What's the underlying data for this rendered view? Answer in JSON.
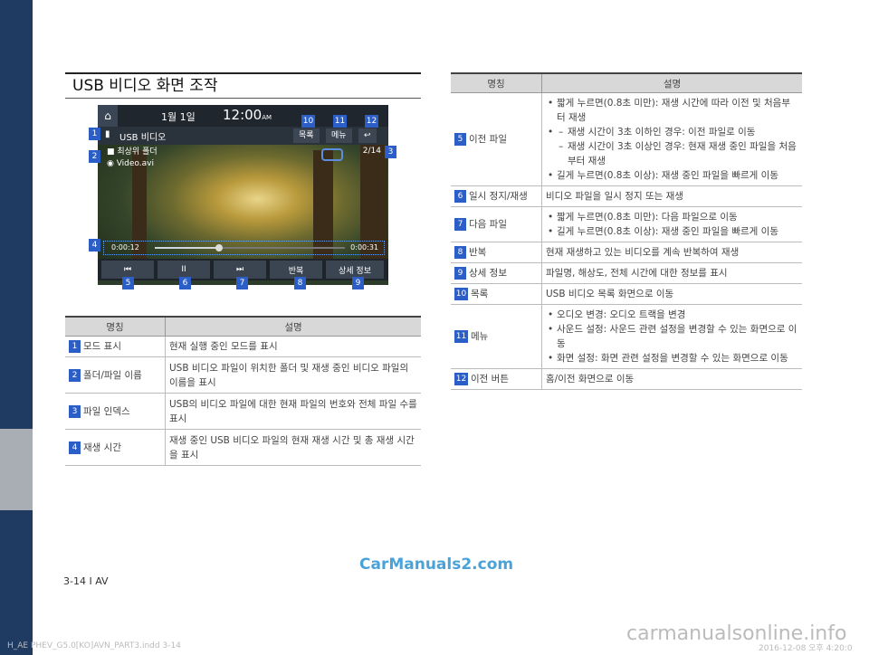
{
  "page_title": "USB 비디오 화면 조작",
  "screen": {
    "date": "1월  1일",
    "clock": "12:00",
    "ampm": "AM",
    "source_title": "USB 비디오",
    "btn_list": "목록",
    "btn_menu": "메뉴",
    "back_symbol": "↩",
    "folder": "최상위 폴더",
    "file": "Video.avi",
    "index": "2/14",
    "time_elapsed": "0:00:12",
    "time_total": "0:00:31",
    "progress": 0.34,
    "prev_symbol": "⏮",
    "pause_symbol": "II",
    "next_symbol": "⏭",
    "btn_repeat": "반복",
    "btn_info": "상세 정보"
  },
  "callouts": [
    "1",
    "2",
    "3",
    "4",
    "5",
    "6",
    "7",
    "8",
    "9",
    "10",
    "11",
    "12"
  ],
  "left_table": {
    "headers": [
      "명칭",
      "설명"
    ],
    "rows": [
      {
        "num": "1",
        "name": "모드 표시",
        "desc": "현재 실행 중인 모드를 표시"
      },
      {
        "num": "2",
        "name": "폴더/파일 이름",
        "desc": "USB 비디오 파일이 위치한 폴더 및 재생 중인 비디오 파일의 이름을 표시"
      },
      {
        "num": "3",
        "name": "파일 인덱스",
        "desc": "USB의 비디오 파일에 대한 현재 파일의 번호와 전체 파일 수를 표시"
      },
      {
        "num": "4",
        "name": "재생 시간",
        "desc": "재생 중인 USB 비디오 파일의 현재 재생 시간 및 총 재생 시간을 표시"
      }
    ]
  },
  "right_table": {
    "headers": [
      "명칭",
      "설명"
    ],
    "r5": {
      "num": "5",
      "name": "이전 파일",
      "b1": "짧게 누르면(0.8초 미만): 재생 시간에 따라 이전 및 처음부터 재생",
      "d1": "재생 시간이 3초 이하인 경우: 이전 파일로 이동",
      "d2": "재생 시간이 3초 이상인 경우: 현재 재생 중인 파일을 처음부터 재생",
      "b2": "길게 누르면(0.8초 이상): 재생 중인 파일을 빠르게 이동"
    },
    "r6": {
      "num": "6",
      "name": "일시 정지/재생",
      "desc": "비디오 파일을 일시 정지 또는 재생"
    },
    "r7": {
      "num": "7",
      "name": "다음 파일",
      "b1": "짧게 누르면(0.8초 미만): 다음 파일으로 이동",
      "b2": "길게 누르면(0.8초 이상): 재생 중인 파일을 빠르게 이동"
    },
    "r8": {
      "num": "8",
      "name": "반복",
      "desc": "현재 재생하고 있는 비디오를 계속 반복하여 재생"
    },
    "r9": {
      "num": "9",
      "name": "상세 정보",
      "desc": "파일명, 해상도, 전체 시간에 대한 정보를 표시"
    },
    "r10": {
      "num": "10",
      "name": "목록",
      "desc": "USB 비디오 목록 화면으로 이동"
    },
    "r11": {
      "num": "11",
      "name": "메뉴",
      "b1": "오디오 변경: 오디오 트랙을 변경",
      "b2": "사운드 설정: 사운드 관련 설정을 변경할 수 있는 화면으로 이동",
      "b3": "화면 설정: 화면 관련 설정을 변경할 수 있는 화면으로 이동"
    },
    "r12": {
      "num": "12",
      "name": "이전 버튼",
      "desc": "홈/이전 화면으로 이동"
    }
  },
  "footer": "3-14 I AV",
  "watermark": "CarManuals2.com",
  "indd_file": "H_AE PHEV_G5.0[KO]AVN_PART3.indd   3-14",
  "indd_date": "2016-12-08   오후 4:20:0",
  "watermark2": "carmanualsonline.info"
}
